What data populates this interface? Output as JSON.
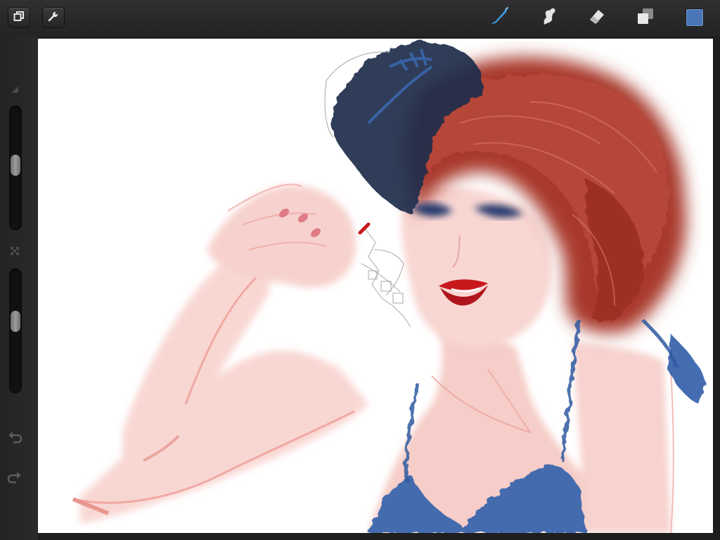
{
  "toolbar": {
    "buttons": [
      {
        "name": "gallery-button",
        "icon": "gallery-icon"
      },
      {
        "name": "actions-button",
        "icon": "wrench-icon"
      }
    ],
    "tools": [
      {
        "name": "brush-tool",
        "icon": "brush-icon",
        "active": true
      },
      {
        "name": "smudge-tool",
        "icon": "smudge-icon",
        "active": false
      },
      {
        "name": "eraser-tool",
        "icon": "eraser-icon",
        "active": false
      },
      {
        "name": "layers-tool",
        "icon": "layers-icon",
        "active": false
      }
    ],
    "current_color": "#4a76b8",
    "active_tool_color": "#3aa0e8"
  },
  "sidebar": {
    "brush_size": {
      "label": "brush-size-slider",
      "value": 0.47
    },
    "opacity": {
      "label": "opacity-slider",
      "value": 0.4
    },
    "controls": [
      {
        "name": "undo-button",
        "icon": "undo-icon"
      },
      {
        "name": "redo-button",
        "icon": "redo-icon"
      }
    ]
  },
  "canvas": {
    "content": "painting",
    "colors": {
      "hair": "#a8372a",
      "hat": "#1e2d4a",
      "skin": "#f6cdc8",
      "lips": "#c8181e",
      "garment": "#3b66ad"
    }
  }
}
